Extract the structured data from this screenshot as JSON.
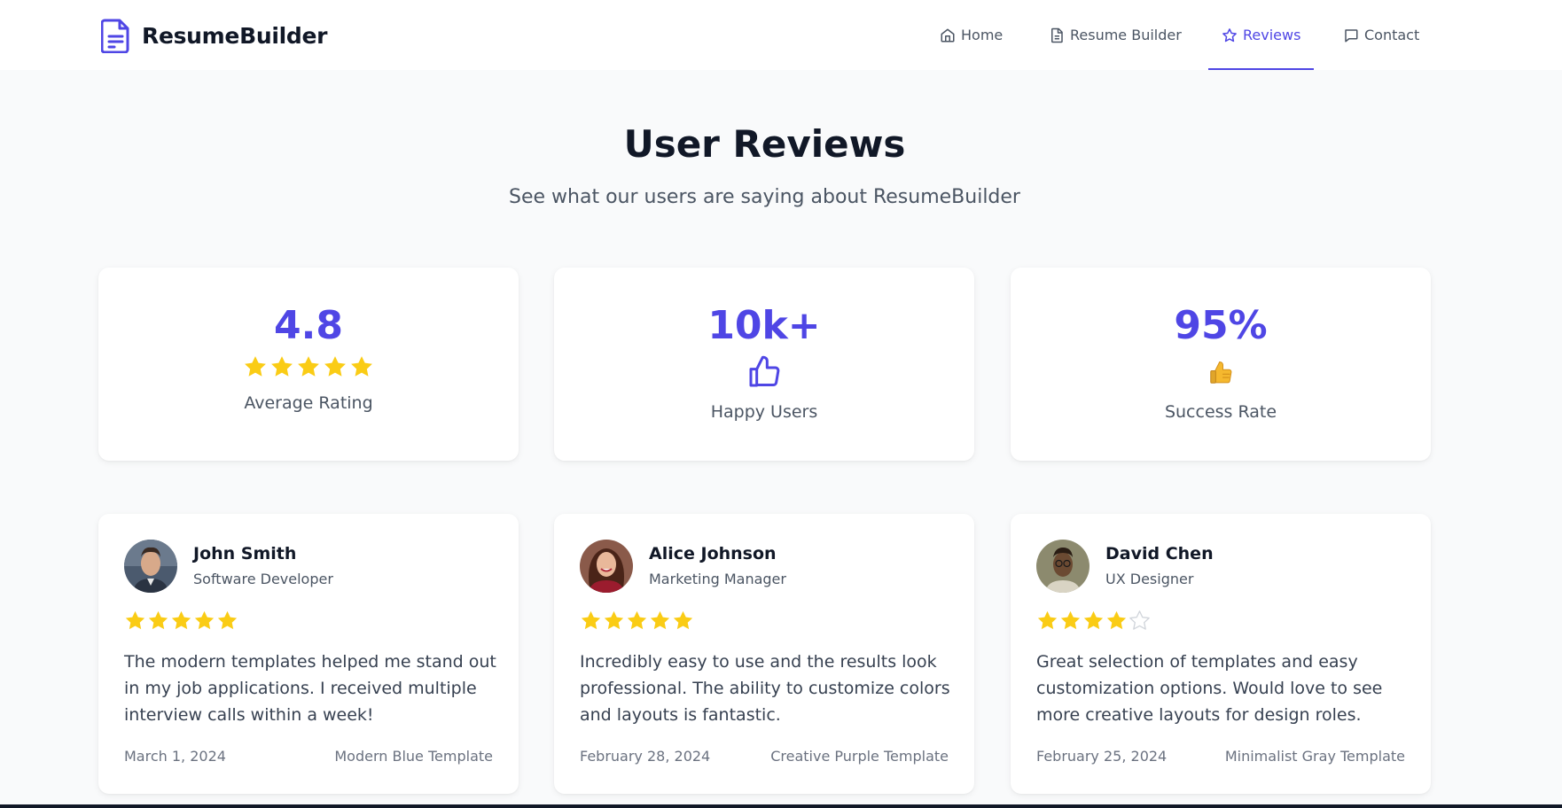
{
  "brand": {
    "name": "ResumeBuilder",
    "icon": "document-icon",
    "color": "#4f46e5"
  },
  "nav": [
    {
      "label": "Home",
      "icon": "home-icon",
      "active": false
    },
    {
      "label": "Resume Builder",
      "icon": "document-icon",
      "active": false
    },
    {
      "label": "Reviews",
      "icon": "star-outline-icon",
      "active": true
    },
    {
      "label": "Contact",
      "icon": "chat-icon",
      "active": false
    }
  ],
  "hero": {
    "title": "User Reviews",
    "subtitle": "See what our users are saying about ResumeBuilder"
  },
  "stats": [
    {
      "value": "4.8",
      "label": "Average Rating",
      "icon": "star-icon",
      "rating": 5
    },
    {
      "value": "10k+",
      "label": "Happy Users",
      "icon": "thumbs-up-outline-icon"
    },
    {
      "value": "95%",
      "label": "Success Rate",
      "icon": "thumbs-up-emoji-icon"
    }
  ],
  "reviews": [
    {
      "name": "John Smith",
      "role": "Software Developer",
      "rating": 5,
      "text": "The modern templates helped me stand out in my job applications. I received multiple interview calls within a week!",
      "date": "March 1, 2024",
      "template": "Modern Blue Template"
    },
    {
      "name": "Alice Johnson",
      "role": "Marketing Manager",
      "rating": 5,
      "text": "Incredibly easy to use and the results look professional. The ability to customize colors and layouts is fantastic.",
      "date": "February 28, 2024",
      "template": "Creative Purple Template"
    },
    {
      "name": "David Chen",
      "role": "UX Designer",
      "rating": 4,
      "text": "Great selection of templates and easy customization options. Would love to see more creative layouts for design roles.",
      "date": "February 25, 2024",
      "template": "Minimalist Gray Template"
    }
  ],
  "colors": {
    "accent": "#4f46e5",
    "star": "#facc15",
    "star_empty": "#d1d5db",
    "text": "#111827",
    "muted": "#4b5563"
  }
}
